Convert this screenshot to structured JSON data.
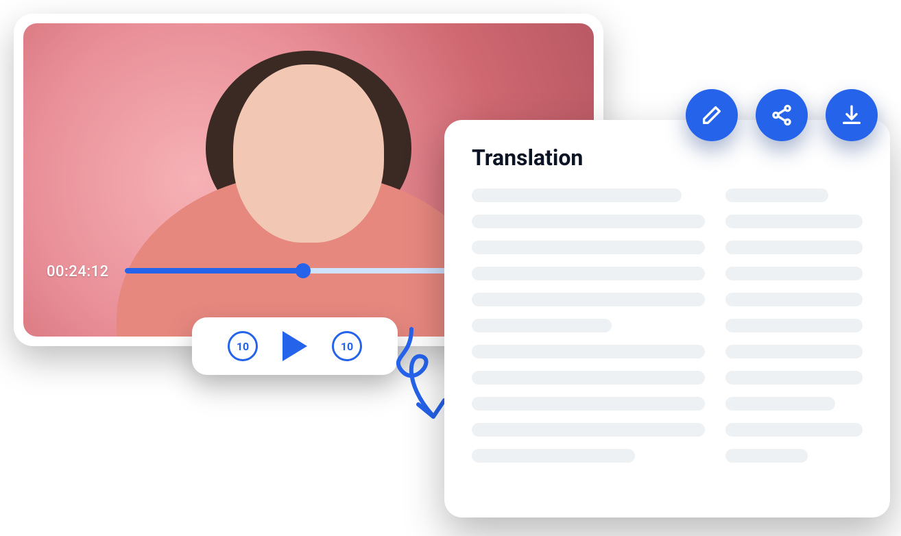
{
  "video": {
    "timecode": "00:24:12",
    "progress_percent": 38,
    "rewind_seconds_label": "10",
    "forward_seconds_label": "10"
  },
  "panel": {
    "title": "Translation"
  },
  "actions": {
    "edit_label": "Edit",
    "share_label": "Share",
    "download_label": "Download"
  },
  "colors": {
    "accent": "#2563eb",
    "placeholder": "#eef1f4",
    "text": "#0b1324"
  }
}
